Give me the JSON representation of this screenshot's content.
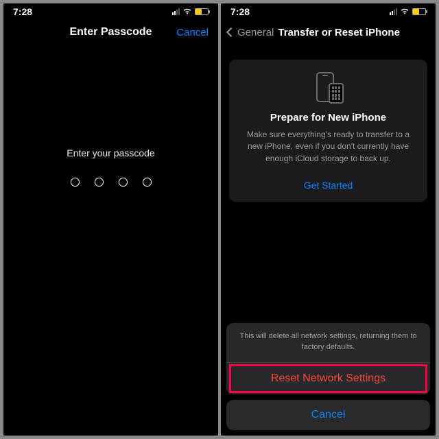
{
  "status": {
    "time": "7:28"
  },
  "left": {
    "title": "Enter Passcode",
    "cancel": "Cancel",
    "prompt": "Enter your passcode",
    "digits": 4
  },
  "right": {
    "back": "General",
    "title": "Transfer or Reset iPhone",
    "card": {
      "title": "Prepare for New iPhone",
      "subtitle": "Make sure everything's ready to transfer to a new iPhone, even if you don't currently have enough iCloud storage to back up.",
      "cta": "Get Started"
    },
    "sheet": {
      "message": "This will delete all network settings, returning them to factory defaults.",
      "action": "Reset Network Settings",
      "cancel": "Cancel"
    }
  }
}
